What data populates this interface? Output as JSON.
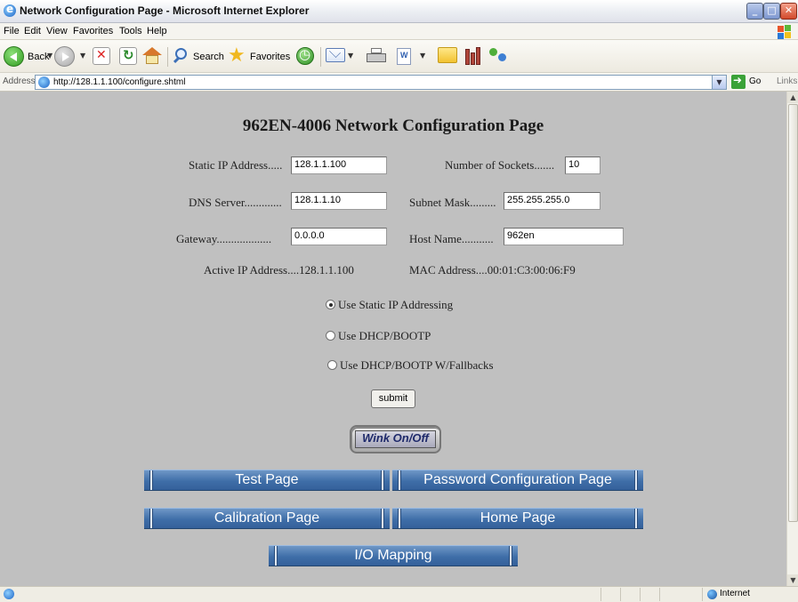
{
  "window": {
    "title": "Network Configuration Page - Microsoft Internet Explorer"
  },
  "menu": [
    "File",
    "Edit",
    "View",
    "Favorites",
    "Tools",
    "Help"
  ],
  "toolbar": {
    "back_label": "Back",
    "search_label": "Search",
    "favorites_label": "Favorites"
  },
  "address": {
    "label": "Address",
    "url": "http://128.1.1.100/configure.shtml",
    "go_label": "Go",
    "links_label": "Links"
  },
  "page": {
    "title": "962EN-4006 Network Configuration Page",
    "static_ip_label": "Static IP Address.....",
    "static_ip_value": "128.1.1.100",
    "num_sockets_label": "Number of Sockets.......",
    "num_sockets_value": "10",
    "dns_label": "DNS Server.............",
    "dns_value": "128.1.1.10",
    "subnet_label": "Subnet Mask.........",
    "subnet_value": "255.255.255.0",
    "gateway_label": "Gateway...................",
    "gateway_value": "0.0.0.0",
    "host_label": "Host Name...........",
    "host_value": "962en",
    "active_ip_text": "Active IP Address....128.1.1.100",
    "mac_text": "MAC Address....00:01:C3:00:06:F9",
    "radio_static": "Use Static IP Addressing",
    "radio_dhcp": "Use DHCP/BOOTP",
    "radio_dhcp_fallback": "Use DHCP/BOOTP W/Fallbacks",
    "submit_label": "submit",
    "wink_label": "Wink On/Off",
    "nav": {
      "test": "Test Page",
      "password": "Password Configuration Page",
      "calibration": "Calibration Page",
      "home": "Home Page",
      "io": "I/O Mapping"
    }
  },
  "status": {
    "zone": "Internet"
  },
  "colors": {
    "page_bg": "#c0c0c0",
    "nav_button": "#4a78b0"
  },
  "icons": [
    "ie-icon",
    "back-icon",
    "forward-icon",
    "stop-icon",
    "refresh-icon",
    "home-icon",
    "search-icon",
    "favorites-star-icon",
    "history-icon",
    "mail-icon",
    "print-icon",
    "edit-icon",
    "discuss-icon",
    "research-icon",
    "messenger-icon",
    "go-arrow-icon",
    "internet-zone-icon"
  ]
}
